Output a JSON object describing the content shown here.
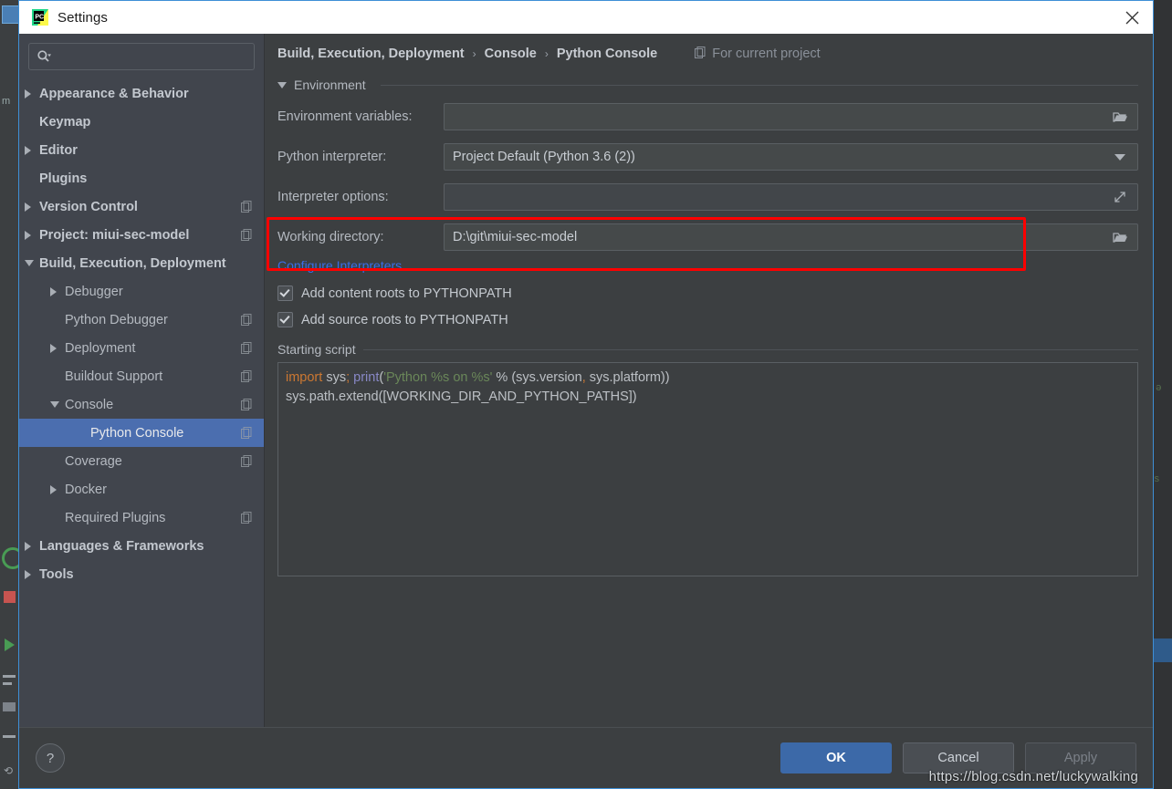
{
  "window": {
    "title": "Settings",
    "app_icon": "pycharm-icon",
    "close_icon": "close-icon"
  },
  "sidebar": {
    "search": {
      "placeholder": "",
      "value": "",
      "icon": "search-icon"
    },
    "items": [
      {
        "label": "Appearance & Behavior",
        "level": 0,
        "arrow": "right",
        "badge": false,
        "selected": false
      },
      {
        "label": "Keymap",
        "level": 0,
        "arrow": "none",
        "badge": false,
        "selected": false
      },
      {
        "label": "Editor",
        "level": 0,
        "arrow": "right",
        "badge": false,
        "selected": false
      },
      {
        "label": "Plugins",
        "level": 0,
        "arrow": "none",
        "badge": false,
        "selected": false
      },
      {
        "label": "Version Control",
        "level": 0,
        "arrow": "right",
        "badge": true,
        "selected": false
      },
      {
        "label": "Project: miui-sec-model",
        "level": 0,
        "arrow": "right",
        "badge": true,
        "selected": false
      },
      {
        "label": "Build, Execution, Deployment",
        "level": 0,
        "arrow": "down",
        "badge": false,
        "selected": false
      },
      {
        "label": "Debugger",
        "level": 1,
        "arrow": "right",
        "badge": false,
        "selected": false
      },
      {
        "label": "Python Debugger",
        "level": 1,
        "arrow": "none",
        "badge": true,
        "selected": false
      },
      {
        "label": "Deployment",
        "level": 1,
        "arrow": "right",
        "badge": true,
        "selected": false
      },
      {
        "label": "Buildout Support",
        "level": 1,
        "arrow": "none",
        "badge": true,
        "selected": false
      },
      {
        "label": "Console",
        "level": 1,
        "arrow": "down",
        "badge": true,
        "selected": false
      },
      {
        "label": "Python Console",
        "level": 2,
        "arrow": "none",
        "badge": true,
        "selected": true
      },
      {
        "label": "Coverage",
        "level": 1,
        "arrow": "none",
        "badge": true,
        "selected": false
      },
      {
        "label": "Docker",
        "level": 1,
        "arrow": "right",
        "badge": false,
        "selected": false
      },
      {
        "label": "Required Plugins",
        "level": 1,
        "arrow": "none",
        "badge": true,
        "selected": false
      },
      {
        "label": "Languages & Frameworks",
        "level": 0,
        "arrow": "right",
        "badge": false,
        "selected": false
      },
      {
        "label": "Tools",
        "level": 0,
        "arrow": "right",
        "badge": false,
        "selected": false
      }
    ]
  },
  "main": {
    "breadcrumb": {
      "segments": [
        "Build, Execution, Deployment",
        "Console",
        "Python Console"
      ],
      "separator": "›",
      "scope_label": "For current project",
      "scope_icon": "project-scope-icon"
    },
    "environment_section": {
      "label": "Environment",
      "collapse_icon": "chevron-down-icon",
      "fields": [
        {
          "label": "Environment variables:",
          "value": "",
          "button_icon": "folder-icon",
          "name": "environment-variables"
        },
        {
          "label": "Python interpreter:",
          "value": "Project Default (Python 3.6 (2))",
          "button_icon": "chevron-down-icon",
          "name": "python-interpreter"
        },
        {
          "label": "Interpreter options:",
          "value": "",
          "button_icon": "expand-icon",
          "name": "interpreter-options"
        },
        {
          "label": "Working directory:",
          "value": "D:\\git\\miui-sec-model",
          "button_icon": "folder-icon",
          "name": "working-directory"
        }
      ],
      "configure_link": "Configure Interpreters",
      "checkboxes": [
        {
          "label": "Add content roots to PYTHONPATH",
          "checked": true,
          "name": "add-content-roots"
        },
        {
          "label": "Add source roots to PYTHONPATH",
          "checked": true,
          "name": "add-source-roots"
        }
      ]
    },
    "starting_script": {
      "label": "Starting script",
      "code_tokens": [
        {
          "t": "import",
          "c": "kw"
        },
        {
          "t": " sys",
          "c": ""
        },
        {
          "t": ";",
          "c": "pn"
        },
        {
          "t": " ",
          "c": ""
        },
        {
          "t": "print",
          "c": "fn"
        },
        {
          "t": "(",
          "c": ""
        },
        {
          "t": "'Python %s on %s'",
          "c": "str"
        },
        {
          "t": " % (sys.version",
          "c": ""
        },
        {
          "t": ",",
          "c": "pn"
        },
        {
          "t": " sys.platform))",
          "c": ""
        },
        {
          "t": "\n",
          "c": ""
        },
        {
          "t": "sys.path.extend([WORKING_DIR_AND_PYTHON_PATHS])",
          "c": ""
        }
      ],
      "plain_text": "import sys; print('Python %s on %s' % (sys.version, sys.platform))\nsys.path.extend([WORKING_DIR_AND_PYTHON_PATHS])"
    }
  },
  "footer": {
    "help_label": "?",
    "ok_label": "OK",
    "cancel_label": "Cancel",
    "apply_label": "Apply"
  },
  "overlay": {
    "watermark": "https://blog.csdn.net/luckywalking",
    "annotation_color": "#ff0000"
  },
  "colors": {
    "selection_blue": "#4b6eaf",
    "primary_button": "#3c69a8",
    "link_blue": "#3a6ee8",
    "panel_bg": "#3c3f41",
    "sidebar_bg": "#41454d",
    "window_border": "#3e8fd6"
  }
}
